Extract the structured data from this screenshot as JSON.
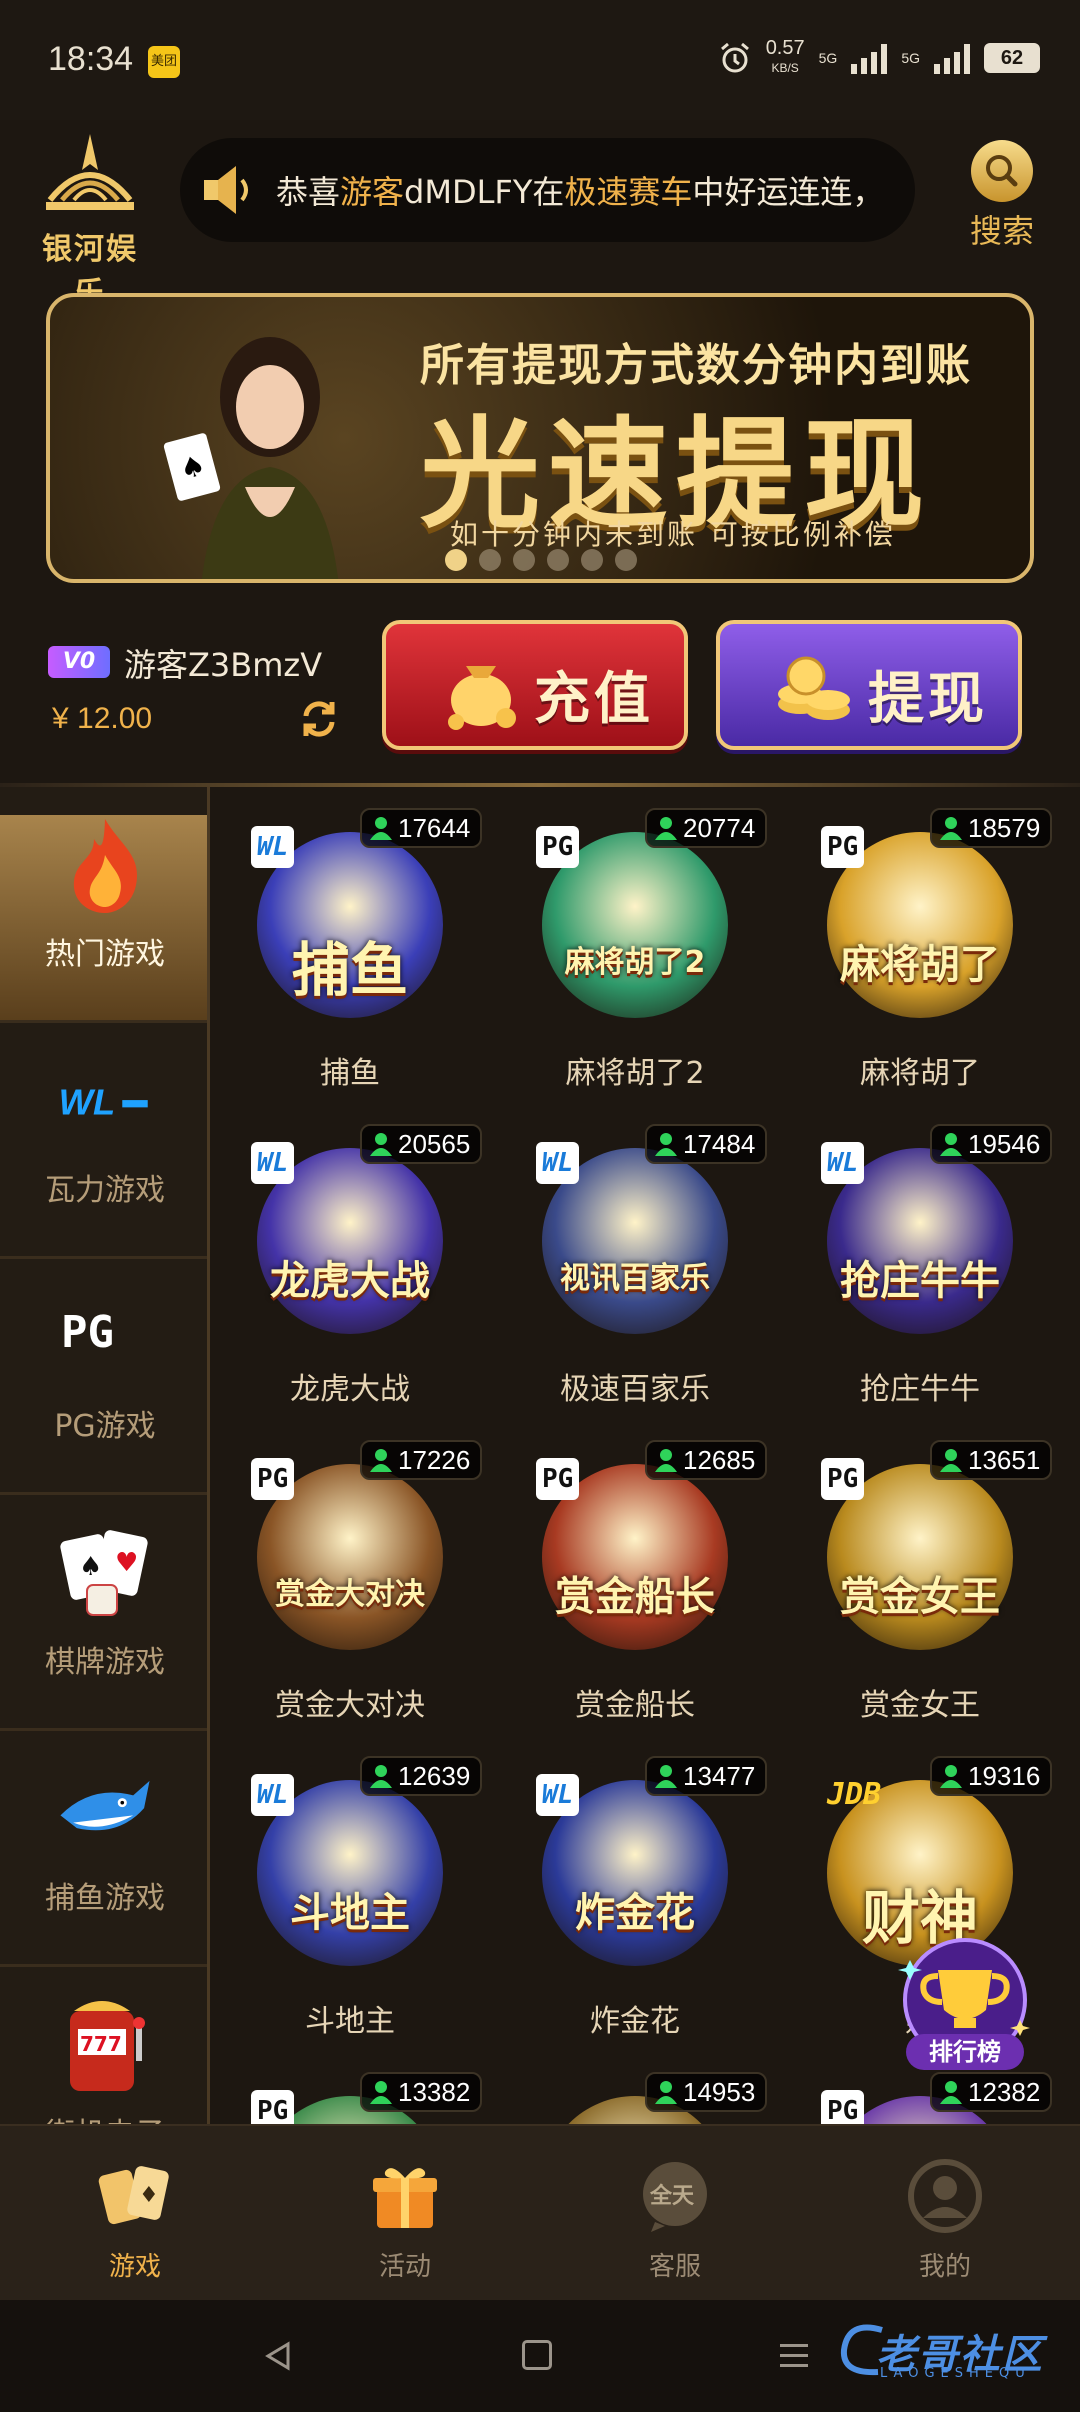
{
  "status_bar": {
    "time": "18:34",
    "app_badge": "美团",
    "net_speed": "0.57",
    "net_unit": "KB/S",
    "signal1": "5G",
    "signal2": "5G",
    "battery": "62"
  },
  "header": {
    "logo_text": "银河娱乐",
    "marquee": {
      "prefix": "恭喜",
      "highlight1": "游客",
      "user": "dMDLFY",
      "mid": "在",
      "highlight2": "极速赛车",
      "suffix": "中好运连连，"
    },
    "search_label": "搜索"
  },
  "banner": {
    "subtitle": "所有提现方式数分钟内到账",
    "title": "光速提现",
    "footer": "如十分钟内未到账  可按比例补偿",
    "dots": 6,
    "active_dot": 0
  },
  "account": {
    "vip": "V0",
    "username": "游客Z3BmzV",
    "balance": "¥ 12.00",
    "deposit_label": "充值",
    "withdraw_label": "提现"
  },
  "nav": [
    {
      "label": "热门游戏",
      "icon": "fire-icon",
      "active": true
    },
    {
      "label": "瓦力游戏",
      "icon": "wl-logo-icon",
      "active": false
    },
    {
      "label": "PG游戏",
      "icon": "pg-logo-icon",
      "active": false
    },
    {
      "label": "棋牌游戏",
      "icon": "cards-icon",
      "active": false
    },
    {
      "label": "捕鱼游戏",
      "icon": "shark-icon",
      "active": false
    },
    {
      "label": "街机电子",
      "icon": "slot-machine-icon",
      "active": false
    },
    {
      "label": "",
      "icon": "live-icon",
      "active": false
    }
  ],
  "games": [
    {
      "name": "捕鱼",
      "online": "17644",
      "brand": "WL",
      "art": "捕鱼",
      "color": "#3b3fb8"
    },
    {
      "name": "麻将胡了2",
      "online": "20774",
      "brand": "PG",
      "art": "麻将胡了2",
      "color": "#2f9a6b"
    },
    {
      "name": "麻将胡了",
      "online": "18579",
      "brand": "PG",
      "art": "麻将胡了",
      "color": "#d9a22a"
    },
    {
      "name": "龙虎大战",
      "online": "20565",
      "brand": "WL",
      "art": "龙虎大战",
      "color": "#4433a8"
    },
    {
      "name": "极速百家乐",
      "online": "17484",
      "brand": "WL",
      "art": "视讯百家乐",
      "color": "#3a4a8a"
    },
    {
      "name": "抢庄牛牛",
      "online": "19546",
      "brand": "WL",
      "art": "抢庄牛牛",
      "color": "#3a2a8c"
    },
    {
      "name": "赏金大对决",
      "online": "17226",
      "brand": "PG",
      "art": "赏金大对决",
      "color": "#8a5526"
    },
    {
      "name": "赏金船长",
      "online": "12685",
      "brand": "PG",
      "art": "赏金船长",
      "color": "#a83a22"
    },
    {
      "name": "赏金女王",
      "online": "13651",
      "brand": "PG",
      "art": "赏金女王",
      "color": "#b98a1e"
    },
    {
      "name": "斗地主",
      "online": "12639",
      "brand": "WL",
      "art": "斗地主",
      "color": "#3440a8"
    },
    {
      "name": "炸金花",
      "online": "13477",
      "brand": "WL",
      "art": "炸金花",
      "color": "#2b3a98"
    },
    {
      "name": "财",
      "online": "19316",
      "brand": "JDB",
      "art": "财神",
      "color": "#c8921f"
    },
    {
      "name": "",
      "online": "13382",
      "brand": "PG",
      "art": "",
      "color": "#3a8a4a"
    },
    {
      "name": "",
      "online": "14953",
      "brand": "",
      "art": "",
      "color": "#8a6a2a"
    },
    {
      "name": "",
      "online": "12382",
      "brand": "PG",
      "art": "",
      "color": "#6a3aa8"
    }
  ],
  "ranking_label": "排行榜",
  "tabs": [
    {
      "label": "游戏",
      "icon": "cards-icon",
      "active": true
    },
    {
      "label": "活动",
      "icon": "gift-icon",
      "active": false
    },
    {
      "label": "客服",
      "icon": "support-icon",
      "active": false,
      "icon_text": "全天"
    },
    {
      "label": "我的",
      "icon": "profile-icon",
      "active": false
    }
  ],
  "watermark": {
    "text": "老哥社区",
    "sub": "LAOGESHEQU"
  },
  "colors": {
    "accent": "#f0b24b",
    "gold_border": "#d9b56b",
    "deposit": "#c81f26",
    "withdraw": "#6a41c9",
    "background": "#1d1711"
  }
}
